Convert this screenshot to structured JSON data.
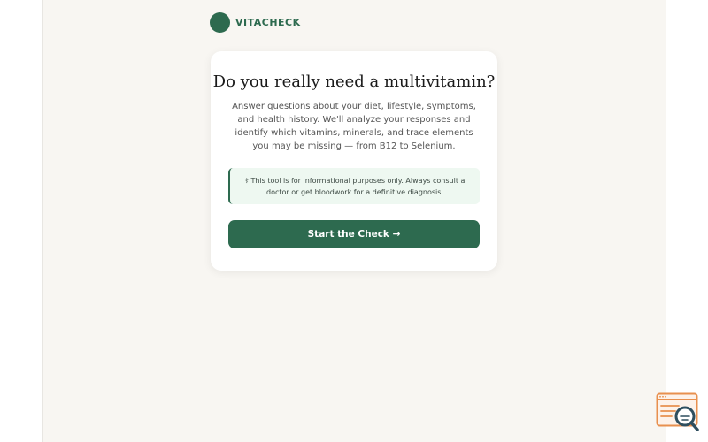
{
  "brand": {
    "name": "VITACHECK",
    "logo_icon": "circle-logo-icon",
    "color": "#2d6a4f"
  },
  "card": {
    "title": "Do you really need a multivitamin?",
    "description": "Answer questions about your diet, lifestyle, symptoms, and health history. We'll analyze your responses and identify which vitamins, minerals, and trace elements you may be missing — from B12 to Selenium.",
    "notice": {
      "icon": "medical-staff-icon",
      "text": "⚕ This tool is for informational purposes only. Always consult a doctor or get bloodwork for a definitive diagnosis."
    },
    "start_button": "Start the Check →"
  },
  "corner_widget": {
    "icon": "search-document-icon",
    "accent": "#e8904f",
    "lens_color": "#2f4f5f"
  },
  "colors": {
    "accent": "#2d6a4f",
    "background": "#f8f6f2",
    "card": "#ffffff",
    "notice_bg": "#eef8f1"
  }
}
